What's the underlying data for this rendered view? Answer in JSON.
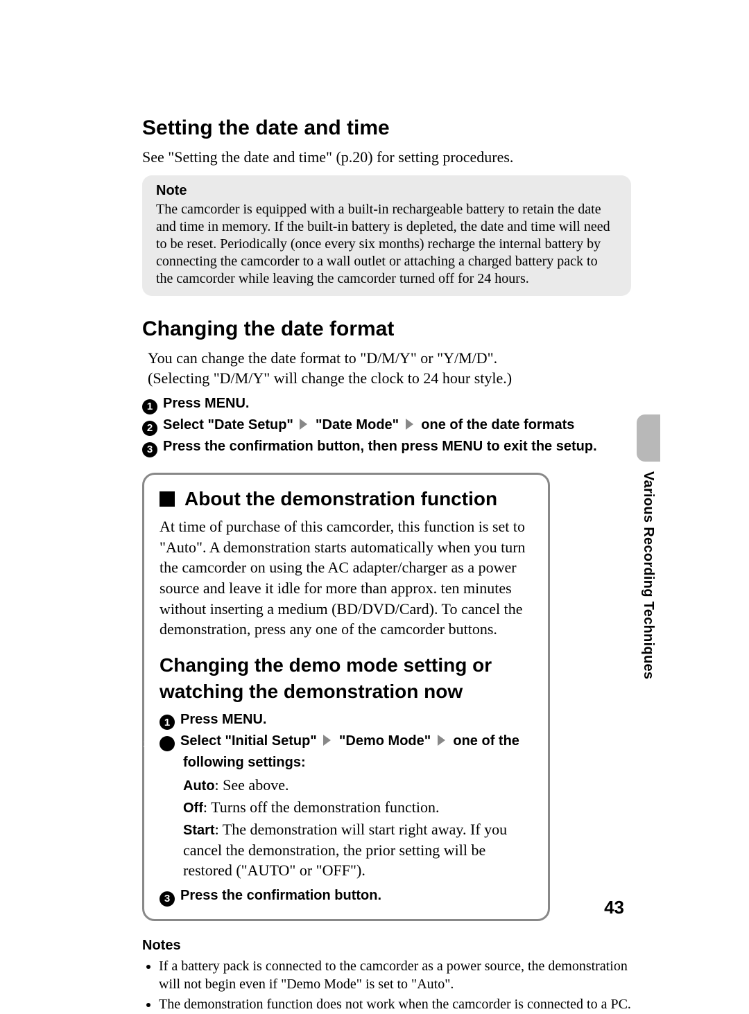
{
  "sideTab": "Various Recording Techniques",
  "pageNumber": "43",
  "section1": {
    "heading": "Setting the date and time",
    "intro": "See \"Setting the date and time\" (p.20) for setting procedures.",
    "noteTitle": "Note",
    "noteBody": "The camcorder is equipped with a built-in rechargeable battery to retain the date and time in memory. If the built-in battery is depleted, the date and time will need to be reset. Periodically (once every six months) recharge the internal battery by connecting the camcorder to a wall outlet or attaching a charged battery pack to the camcorder while leaving the camcorder turned off for 24 hours."
  },
  "section2": {
    "heading": "Changing the date format",
    "line1": "You can change the date format to \"D/M/Y\" or \"Y/M/D\".",
    "line2": "(Selecting \"D/M/Y\" will change the clock to 24 hour style.)",
    "step1": "Press MENU.",
    "step2a": "Select \"Date Setup\"",
    "step2b": "\"Date Mode\"",
    "step2c": "one of the date formats",
    "step3": "Press the confirmation button, then press MENU to exit the setup."
  },
  "boxDemo": {
    "heading": "About the demonstration function",
    "body": "At time of purchase of this camcorder, this function is set to \"Auto\". A demonstration starts automatically when you turn the camcorder on using the AC adapter/charger as a power source and leave it idle for more than approx. ten minutes without inserting a medium (BD/DVD/Card). To cancel the demonstration, press any one of the camcorder buttons.",
    "heading2": "Changing the demo mode setting or watching the demonstration now",
    "step1": "Press MENU.",
    "step2a": "Select \"Initial Setup\"",
    "step2b": "\"Demo Mode\"",
    "step2c": "one of the following settings:",
    "settings": {
      "autoLabel": "Auto",
      "autoText": ": See above.",
      "offLabel": "Off",
      "offText": ": Turns off the demonstration function.",
      "startLabel": "Start",
      "startText": ": The demonstration will start right away. If you cancel the demonstration, the prior setting will be restored (\"AUTO\" or \"OFF\")."
    },
    "step3": "Press the confirmation button."
  },
  "notes2": {
    "title": "Notes",
    "item1": "If a battery pack is connected to the camcorder as a power source, the demonstration will not begin even if \"Demo Mode\" is set to \"Auto\".",
    "item2": "The demonstration function does not work when the camcorder is connected to a PC."
  }
}
